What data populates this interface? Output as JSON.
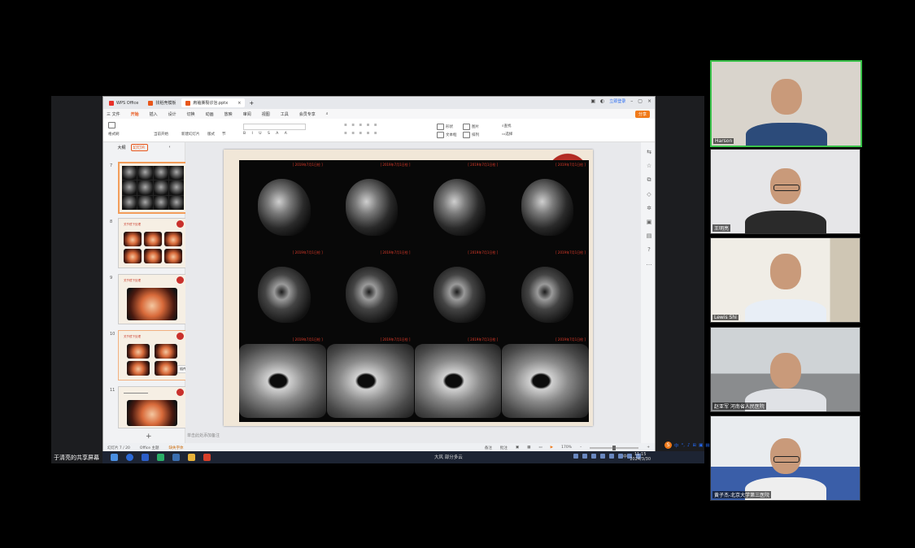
{
  "screen_share": {
    "label": "于清亮的共享屏幕"
  },
  "wps": {
    "tabs": [
      {
        "label": "WPS Office",
        "color": "#e8302a"
      },
      {
        "label": "找稻壳模板",
        "color": "#e8561a"
      },
      {
        "label": "肩袖撕裂诊治.pptx",
        "color": "#e8561a",
        "active": true
      }
    ],
    "new_tab": "+",
    "login": "立即登录",
    "menu": [
      "三 文件",
      "开始",
      "插入",
      "设计",
      "切换",
      "动画",
      "放映",
      "审阅",
      "视图",
      "工具",
      "会员专享"
    ],
    "active_menu": "开始",
    "share_btn": "分享",
    "ribbon": {
      "paste": "格式刷",
      "from": "当前开始",
      "new_slide": "新建幻灯片",
      "layout": "版式",
      "section": "节",
      "shapes": "形状",
      "replace": "替换",
      "textbox": "文本框",
      "arrange": "排列",
      "picture": "图片",
      "find": "查找",
      "select": "选择"
    },
    "panel_tabs": [
      "大纲",
      "幻灯片"
    ],
    "slides": [
      {
        "num": "7",
        "selected": true,
        "type": "mri"
      },
      {
        "num": "8",
        "title": "关节镜下处理",
        "type": "endo6"
      },
      {
        "num": "9",
        "title": "关节镜下处理",
        "type": "endo1"
      },
      {
        "num": "10",
        "title": "关节镜下处理",
        "type": "endo4",
        "caption": "插件图片 插图"
      },
      {
        "num": "11",
        "title": "",
        "type": "endo1b"
      }
    ],
    "add_slide": "+",
    "mri_stamp": "[ 2019年7月1日检 ]",
    "notes": "单击此处添加备注",
    "ime": [
      "中",
      "°,",
      "♪",
      "⊞",
      "▣",
      "▤"
    ],
    "status": {
      "slide": "幻灯片 7 / 20",
      "theme": "Office 主题",
      "missing_font": "缺失字体",
      "notes": "备注",
      "comments": "批注",
      "zoom": "170%"
    }
  },
  "taskbar": {
    "weather": "大风 部分多云",
    "lang": "中",
    "time": "11:15",
    "date": "2024/3/30"
  },
  "participants": [
    {
      "name": "Harson",
      "active": true,
      "bg": "#d9d4cc",
      "shirt": "#2c4b7a",
      "glasses": false
    },
    {
      "name": "王明亮",
      "active": false,
      "bg": "#e6e6e8",
      "shirt": "#2a2a2a",
      "glasses": true
    },
    {
      "name": "Lewis Shi",
      "active": false,
      "bg": "#f0ede6",
      "shirt": "#e8eef6",
      "glasses": false
    },
    {
      "name": "赵亚军 河南省人民医院",
      "active": false,
      "bg": "#cfd3d6",
      "shirt": "#e0e2e6",
      "glasses": false
    },
    {
      "name": "黄子杰-北京大学第三医院",
      "active": false,
      "bg": "#e9ecef",
      "shirt": "#eeeeee",
      "glasses": true
    }
  ],
  "icons": [
    "wps-logo-icon",
    "close-icon",
    "minimize-icon",
    "maximize-icon",
    "search-icon",
    "windows-start-icon"
  ]
}
